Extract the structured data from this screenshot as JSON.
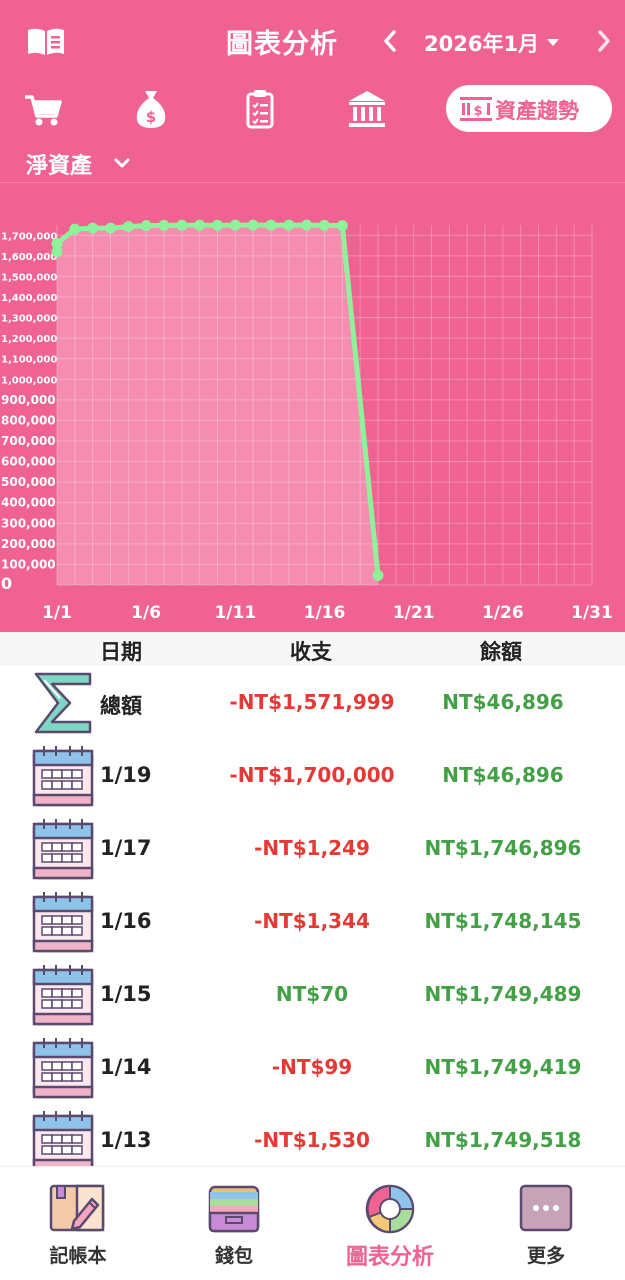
{
  "header": {
    "title": "圖表分析",
    "month": "2026年1月"
  },
  "tabs": {
    "items": [
      "cart",
      "money-bag",
      "clipboard",
      "bank"
    ],
    "active_label": "資產趨勢"
  },
  "selector": {
    "label": "淨資產"
  },
  "colors": {
    "primary": "#f06292",
    "line": "#8ef29a",
    "negative": "#e53935",
    "positive": "#43a047"
  },
  "chart_data": {
    "type": "area",
    "y_tick_labels": [
      "1,700,000",
      "1,600,000",
      "1,500,000",
      "1,400,000",
      "1,300,000",
      "1,200,000",
      "1,100,000",
      "1,000,000",
      "900,000",
      "800,000",
      "700,000",
      "600,000",
      "500,000",
      "400,000",
      "300,000",
      "200,000",
      "100,000",
      "0"
    ],
    "x_tick_labels": [
      "1/1",
      "1/6",
      "1/11",
      "1/16",
      "1/21",
      "1/26",
      "1/31"
    ],
    "x_range": [
      1,
      31
    ],
    "y_range": [
      0,
      1750000
    ],
    "grid": true,
    "series": [
      {
        "x": [
          1,
          1,
          2,
          3,
          4,
          5,
          6,
          7,
          8,
          9,
          10,
          11,
          12,
          13,
          14,
          15,
          16,
          17,
          19
        ],
        "values": [
          1620000,
          1660000,
          1730000,
          1735000,
          1735000,
          1742000,
          1746896,
          1748000,
          1748500,
          1749000,
          1749000,
          1749200,
          1749300,
          1749518,
          1749419,
          1749489,
          1748145,
          1746896,
          46896
        ]
      }
    ]
  },
  "table": {
    "headers": {
      "date": "日期",
      "amount": "收支",
      "balance": "餘額"
    },
    "rows": [
      {
        "label": "總額",
        "amount": "-NT$1,571,999",
        "balance": "NT$46,896",
        "amount_sign": "neg",
        "icon": "sigma-icon"
      },
      {
        "label": "1/19",
        "amount": "-NT$1,700,000",
        "balance": "NT$46,896",
        "amount_sign": "neg",
        "icon": "calendar-icon"
      },
      {
        "label": "1/17",
        "amount": "-NT$1,249",
        "balance": "NT$1,746,896",
        "amount_sign": "neg",
        "icon": "calendar-icon"
      },
      {
        "label": "1/16",
        "amount": "-NT$1,344",
        "balance": "NT$1,748,145",
        "amount_sign": "neg",
        "icon": "calendar-icon"
      },
      {
        "label": "1/15",
        "amount": "NT$70",
        "balance": "NT$1,749,489",
        "amount_sign": "pos",
        "icon": "calendar-icon"
      },
      {
        "label": "1/14",
        "amount": "-NT$99",
        "balance": "NT$1,749,419",
        "amount_sign": "neg",
        "icon": "calendar-icon"
      },
      {
        "label": "1/13",
        "amount": "-NT$1,530",
        "balance": "NT$1,749,518",
        "amount_sign": "neg",
        "icon": "calendar-icon"
      }
    ]
  },
  "bottom_nav": {
    "items": [
      {
        "label": "記帳本",
        "icon": "notebook-icon"
      },
      {
        "label": "錢包",
        "icon": "wallet-icon"
      },
      {
        "label": "圖表分析",
        "icon": "pie-chart-icon",
        "active": true
      },
      {
        "label": "更多",
        "icon": "more-icon"
      }
    ]
  }
}
